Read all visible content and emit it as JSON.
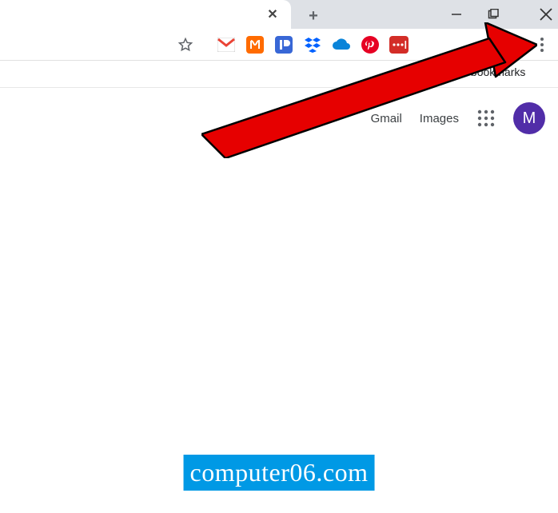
{
  "tab": {
    "close_glyph": "✕"
  },
  "newtab_glyph": "+",
  "bookmarks": {
    "other_label": "Other bookmarks"
  },
  "google_header": {
    "gmail": "Gmail",
    "images": "Images",
    "avatar_initial": "M"
  },
  "watermark": "computer06.com",
  "colors": {
    "arrow": "#e60000",
    "avatar_bg": "#512da8",
    "watermark_bg": "#0099e5",
    "pinterest": "#e60023",
    "lastpass": "#d32d27",
    "gmail": "#ea4335",
    "onedrive": "#0a84d9",
    "folder": "#ffd24d"
  },
  "icons": {
    "star": "star-icon",
    "gmail": "gmail-icon",
    "honey": "honey-icon",
    "pushbullet": "pushbullet-icon",
    "dropbox": "dropbox-icon",
    "onedrive": "onedrive-icon",
    "pinterest": "pinterest-icon",
    "lastpass": "lastpass-icon",
    "profile": "profile-icon",
    "kebab": "kebab-menu-icon",
    "apps": "apps-grid-icon",
    "folder": "folder-icon"
  }
}
